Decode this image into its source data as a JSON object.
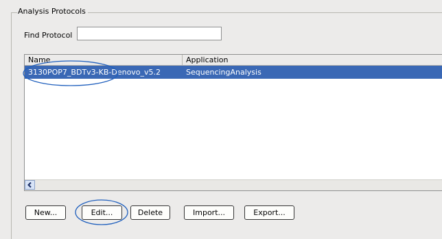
{
  "group": {
    "title": "Analysis Protocols"
  },
  "find": {
    "label": "Find Protocol",
    "value": "",
    "placeholder": ""
  },
  "table": {
    "columns": [
      "Name",
      "Application"
    ],
    "rows": [
      {
        "name": "3130POP7_BDTv3-KB-Denovo_v5.2",
        "application": "SequencingAnalysis",
        "selected": true
      }
    ]
  },
  "scrollbar": {
    "left_icon": "chevron-left-icon"
  },
  "buttons": {
    "new": "New...",
    "edit": "Edit...",
    "delete": "Delete",
    "import": "Import...",
    "export": "Export..."
  },
  "colors": {
    "selection": "#3a68b5",
    "annotation": "#1f5fbd",
    "background": "#ecebea"
  }
}
